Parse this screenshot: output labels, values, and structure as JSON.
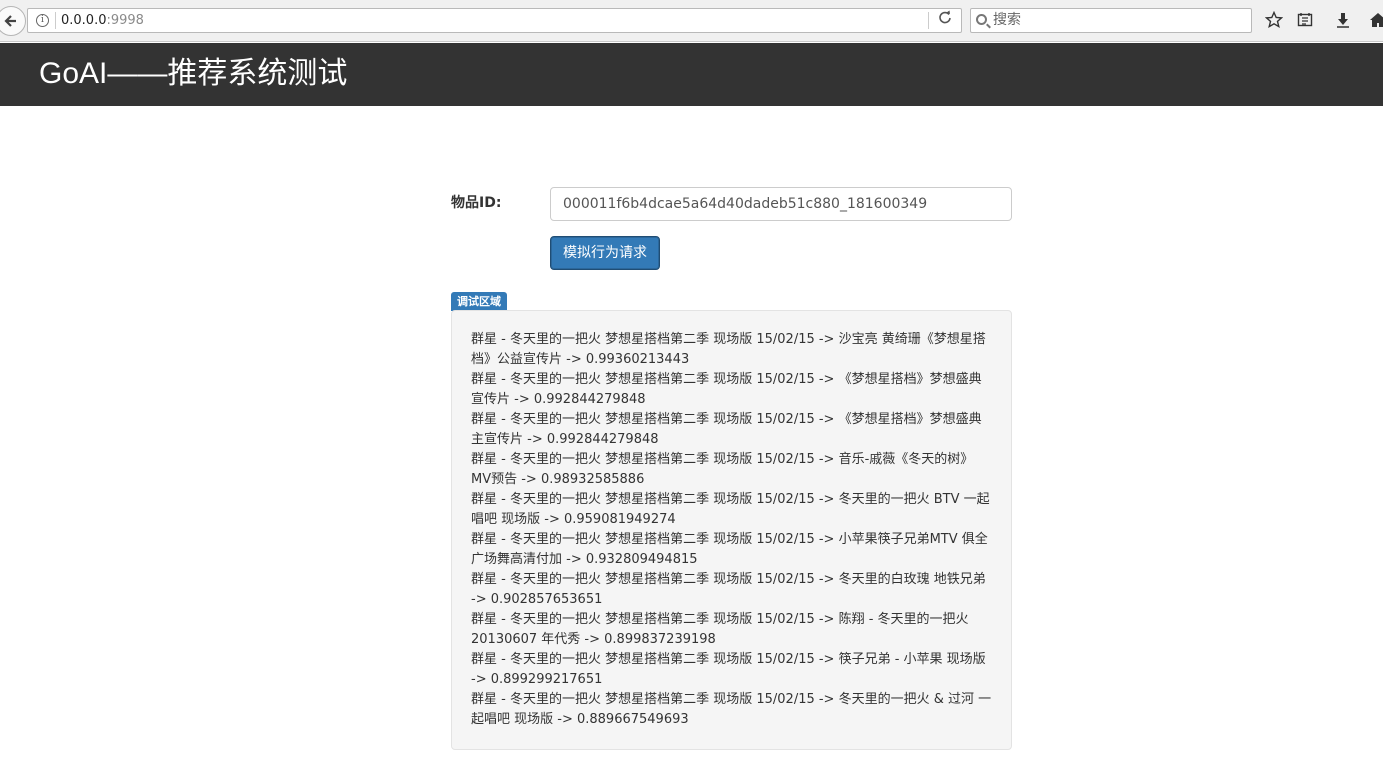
{
  "browser": {
    "url_host": "0.0.0.0",
    "url_port": ":9998",
    "search_placeholder": "搜索"
  },
  "header": {
    "title": "GoAI——推荐系统测试"
  },
  "form": {
    "id_label": "物品ID:",
    "id_value": "000011f6b4dcae5a64d40dadeb51c880_181600349",
    "submit_label": "模拟行为请求"
  },
  "debug": {
    "badge": "调试区域",
    "results": [
      "群星 - 冬天里的一把火 梦想星搭档第二季 现场版 15/02/15 -> 沙宝亮 黄绮珊《梦想星搭档》公益宣传片 -> 0.99360213443",
      "群星 - 冬天里的一把火 梦想星搭档第二季 现场版 15/02/15 -> 《梦想星搭档》梦想盛典宣传片 -> 0.992844279848",
      "群星 - 冬天里的一把火 梦想星搭档第二季 现场版 15/02/15 -> 《梦想星搭档》梦想盛典 主宣传片 -> 0.992844279848",
      "群星 - 冬天里的一把火 梦想星搭档第二季 现场版 15/02/15 -> 音乐-戚薇《冬天的树》MV预告 -> 0.98932585886",
      "群星 - 冬天里的一把火 梦想星搭档第二季 现场版 15/02/15 -> 冬天里的一把火 BTV 一起唱吧 现场版 -> 0.959081949274",
      "群星 - 冬天里的一把火 梦想星搭档第二季 现场版 15/02/15 -> 小苹果筷子兄弟MTV 俱全广场舞高清付加 -> 0.932809494815",
      "群星 - 冬天里的一把火 梦想星搭档第二季 现场版 15/02/15 -> 冬天里的白玫瑰 地铁兄弟 -> 0.902857653651",
      "群星 - 冬天里的一把火 梦想星搭档第二季 现场版 15/02/15 -> 陈翔 - 冬天里的一把火 20130607 年代秀 -> 0.899837239198",
      "群星 - 冬天里的一把火 梦想星搭档第二季 现场版 15/02/15 -> 筷子兄弟 - 小苹果 现场版 -> 0.899299217651",
      "群星 - 冬天里的一把火 梦想星搭档第二季 现场版 15/02/15 -> 冬天里的一把火 & 过河 一起唱吧 现场版 -> 0.889667549693"
    ]
  }
}
